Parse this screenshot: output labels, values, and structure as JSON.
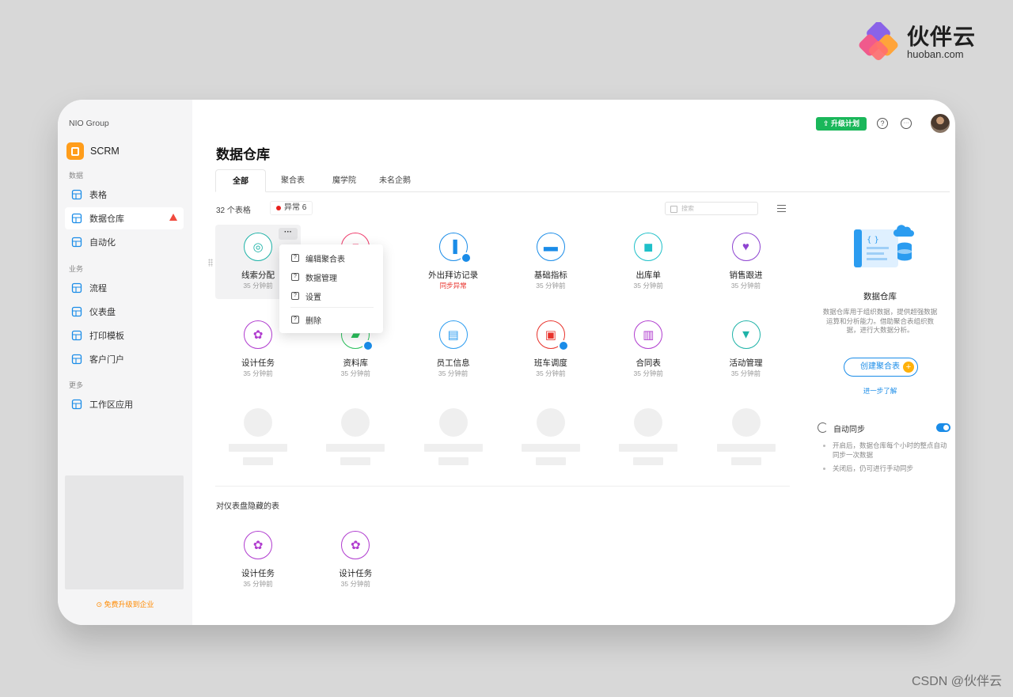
{
  "brand": {
    "name": "伙伴云",
    "domain": "huoban.com"
  },
  "watermark": "CSDN @伙伴云",
  "sidebar": {
    "org": "NIO Group",
    "app_name": "SCRM",
    "sections": [
      "数据",
      "业务",
      "更多"
    ],
    "items": [
      {
        "label": "表格",
        "icon": "table-icon"
      },
      {
        "label": "数据仓库",
        "icon": "database-icon",
        "active": true,
        "warning": true
      },
      {
        "label": "自动化",
        "icon": "robot-icon"
      },
      {
        "label": "流程",
        "icon": "flow-icon"
      },
      {
        "label": "仪表盘",
        "icon": "chart-pie-icon"
      },
      {
        "label": "打印模板",
        "icon": "printer-icon"
      },
      {
        "label": "客户门户",
        "icon": "portal-icon"
      },
      {
        "label": "工作区应用",
        "icon": "apps-grid-icon"
      }
    ],
    "upgrade_enterprise": "免费升级到企业"
  },
  "header": {
    "upgrade_plan": "升级计划",
    "help": "?",
    "more": "···"
  },
  "page": {
    "title": "数据仓库",
    "tabs": [
      "全部",
      "聚合表",
      "魔学院",
      "未名企鹅"
    ],
    "count": "32 个表格",
    "abnormal": "异常 6",
    "search_placeholder": "搜索"
  },
  "cards": [
    {
      "name": "线索分配",
      "status": "35 分钟前",
      "color": "#1fb3a8",
      "glyph": "◎"
    },
    {
      "name": "用户画像",
      "status": "35 分钟前",
      "color": "#ef3b6b",
      "glyph": "■"
    },
    {
      "name": "外出拜访记录",
      "status": "同步异常",
      "color": "#1a8ce8",
      "glyph": "▐",
      "error": true,
      "badge": true
    },
    {
      "name": "基础指标",
      "status": "35 分钟前",
      "color": "#1a8ce8",
      "glyph": "▬",
      "folder": true
    },
    {
      "name": "出库单",
      "status": "35 分钟前",
      "color": "#1fc0c9",
      "glyph": "◼"
    },
    {
      "name": "销售跟进",
      "status": "35 分钟前",
      "color": "#8e44d1",
      "glyph": "♥"
    },
    {
      "name": "设计任务",
      "status": "35 分钟前",
      "color": "#b03ccf",
      "glyph": "✿"
    },
    {
      "name": "资料库",
      "status": "35 分钟前",
      "color": "#2ac05c",
      "glyph": "▰",
      "badge": true
    },
    {
      "name": "员工信息",
      "status": "35 分钟前",
      "color": "#2b9cf0",
      "glyph": "▤"
    },
    {
      "name": "班车调度",
      "status": "35 分钟前",
      "color": "#e8322b",
      "glyph": "▣",
      "badge": true
    },
    {
      "name": "合同表",
      "status": "35 分钟前",
      "color": "#b03ccf",
      "glyph": "▥"
    },
    {
      "name": "活动管理",
      "status": "35 分钟前",
      "color": "#1fb3a8",
      "glyph": "▼"
    }
  ],
  "context_menu": [
    "编辑聚合表",
    "数据管理",
    "设置",
    "删除"
  ],
  "hidden_section": {
    "title": "对仪表盘隐藏的表",
    "cards": [
      {
        "name": "设计任务",
        "status": "35 分钟前",
        "color": "#b03ccf",
        "glyph": "✿"
      },
      {
        "name": "设计任务",
        "status": "35 分钟前",
        "color": "#b03ccf",
        "glyph": "✿"
      }
    ]
  },
  "panel": {
    "title": "数据仓库",
    "description": "数据仓库用于组织数据，提供超强数据运算和分析能力。借助聚合表组织数据，进行大数据分析。",
    "create_button": "创建聚合表",
    "learn_more": "进一步了解",
    "sync_label": "自动同步",
    "sync_enabled": true,
    "notes": [
      "开启后，数据仓库每个小时的整点自动同步一次数据",
      "关闭后，仍可进行手动同步"
    ]
  }
}
